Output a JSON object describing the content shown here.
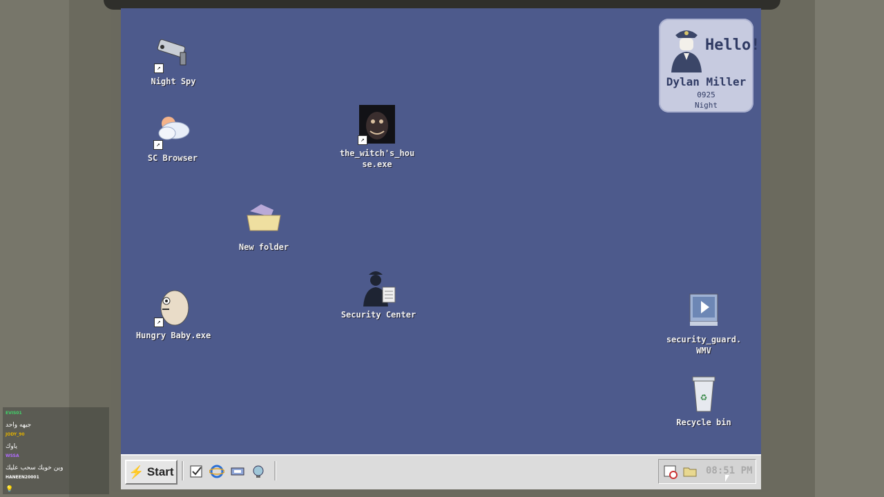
{
  "desktop": {
    "hello_card": {
      "greeting": "Hello!",
      "name": "Dylan Miller",
      "id": "0925",
      "shift": "Night"
    },
    "icons": [
      {
        "label": "Night Spy",
        "icon": "cctv-camera-icon",
        "shortcut": true
      },
      {
        "label": "SC Browser",
        "icon": "cloud-sun-icon",
        "shortcut": true
      },
      {
        "label": "the_witch's_house.exe",
        "icon": "witch-face-icon",
        "shortcut": true
      },
      {
        "label": "New folder",
        "icon": "folder-icon",
        "shortcut": false
      },
      {
        "label": "Hungry Baby.exe",
        "icon": "baby-creature-icon",
        "shortcut": true
      },
      {
        "label": "Security Center",
        "icon": "security-guard-icon",
        "shortcut": false
      },
      {
        "label": "security_guard.WMV",
        "icon": "video-file-icon",
        "shortcut": false
      },
      {
        "label": "Recycle bin",
        "icon": "recycle-bin-icon",
        "shortcut": false
      }
    ]
  },
  "taskbar": {
    "start_label": "Start",
    "quick_launch": [
      "notepad-icon",
      "internet-explorer-icon",
      "network-icon",
      "globe-icon"
    ],
    "tray_icons": [
      "calendar-icon",
      "folder-tray-icon"
    ],
    "clock": "08:51 PM"
  },
  "chat": [
    {
      "user": "EVIS01",
      "user_color": "#43d16a",
      "text": "جيهه واحد"
    },
    {
      "user": "JODY_90",
      "user_color": "#e1b000",
      "text": "ياوك"
    },
    {
      "user": "WSSA",
      "user_color": "#b26cff",
      "text": "وين خويك سحب عليك"
    },
    {
      "user": "HANEEN20001",
      "user_color": "#ffffff",
      "text": "💡"
    }
  ]
}
